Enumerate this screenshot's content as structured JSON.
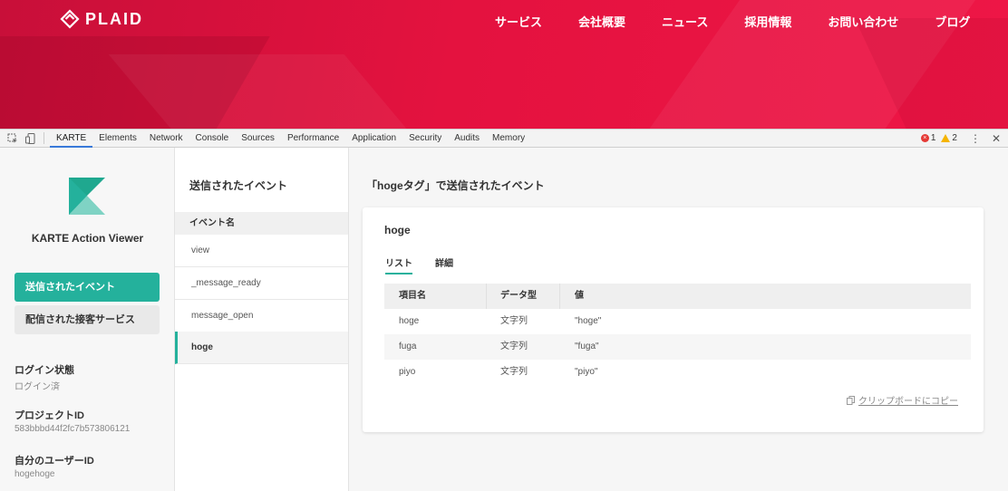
{
  "site": {
    "logo_text": "PLAID",
    "nav": [
      "サービス",
      "会社概要",
      "ニュース",
      "採用情報",
      "お問い合わせ",
      "ブログ"
    ]
  },
  "devtools": {
    "tabs": [
      "KARTE",
      "Elements",
      "Network",
      "Console",
      "Sources",
      "Performance",
      "Application",
      "Security",
      "Audits",
      "Memory"
    ],
    "active_tab": "KARTE",
    "error_count": "1",
    "warning_count": "2",
    "icons": [
      "inspect-icon",
      "device-toggle-icon",
      "error-icon",
      "warning-icon",
      "more-icon",
      "close-icon"
    ]
  },
  "sidebar": {
    "app_title": "KARTE Action Viewer",
    "menu": [
      "送信されたイベント",
      "配信された接客サービス"
    ],
    "info": [
      {
        "label": "ログイン状態",
        "value": "ログイン済"
      },
      {
        "label": "プロジェクトID",
        "value": "583bbbd44f2fc7b573806121"
      },
      {
        "label": "自分のユーザーID",
        "value": "hogehoge"
      }
    ]
  },
  "events": {
    "title": "送信されたイベント",
    "header": "イベント名",
    "items": [
      "view",
      "_message_ready",
      "message_open",
      "hoge"
    ],
    "selected": "hoge"
  },
  "main": {
    "title": "「hogeタグ」で送信されたイベント",
    "card": {
      "title": "hoge",
      "tabs": [
        "リスト",
        "詳細"
      ],
      "columns": [
        "項目名",
        "データ型",
        "値"
      ],
      "rows": [
        [
          "hoge",
          "文字列",
          "\"hoge\""
        ],
        [
          "fuga",
          "文字列",
          "\"fuga\""
        ],
        [
          "piyo",
          "文字列",
          "\"piyo\""
        ]
      ],
      "copy_label": "クリップボードにコピー"
    }
  },
  "colors": {
    "brand_red": "#e4123f",
    "accent_teal": "#24b19c",
    "devtools_active": "#3879d9"
  }
}
